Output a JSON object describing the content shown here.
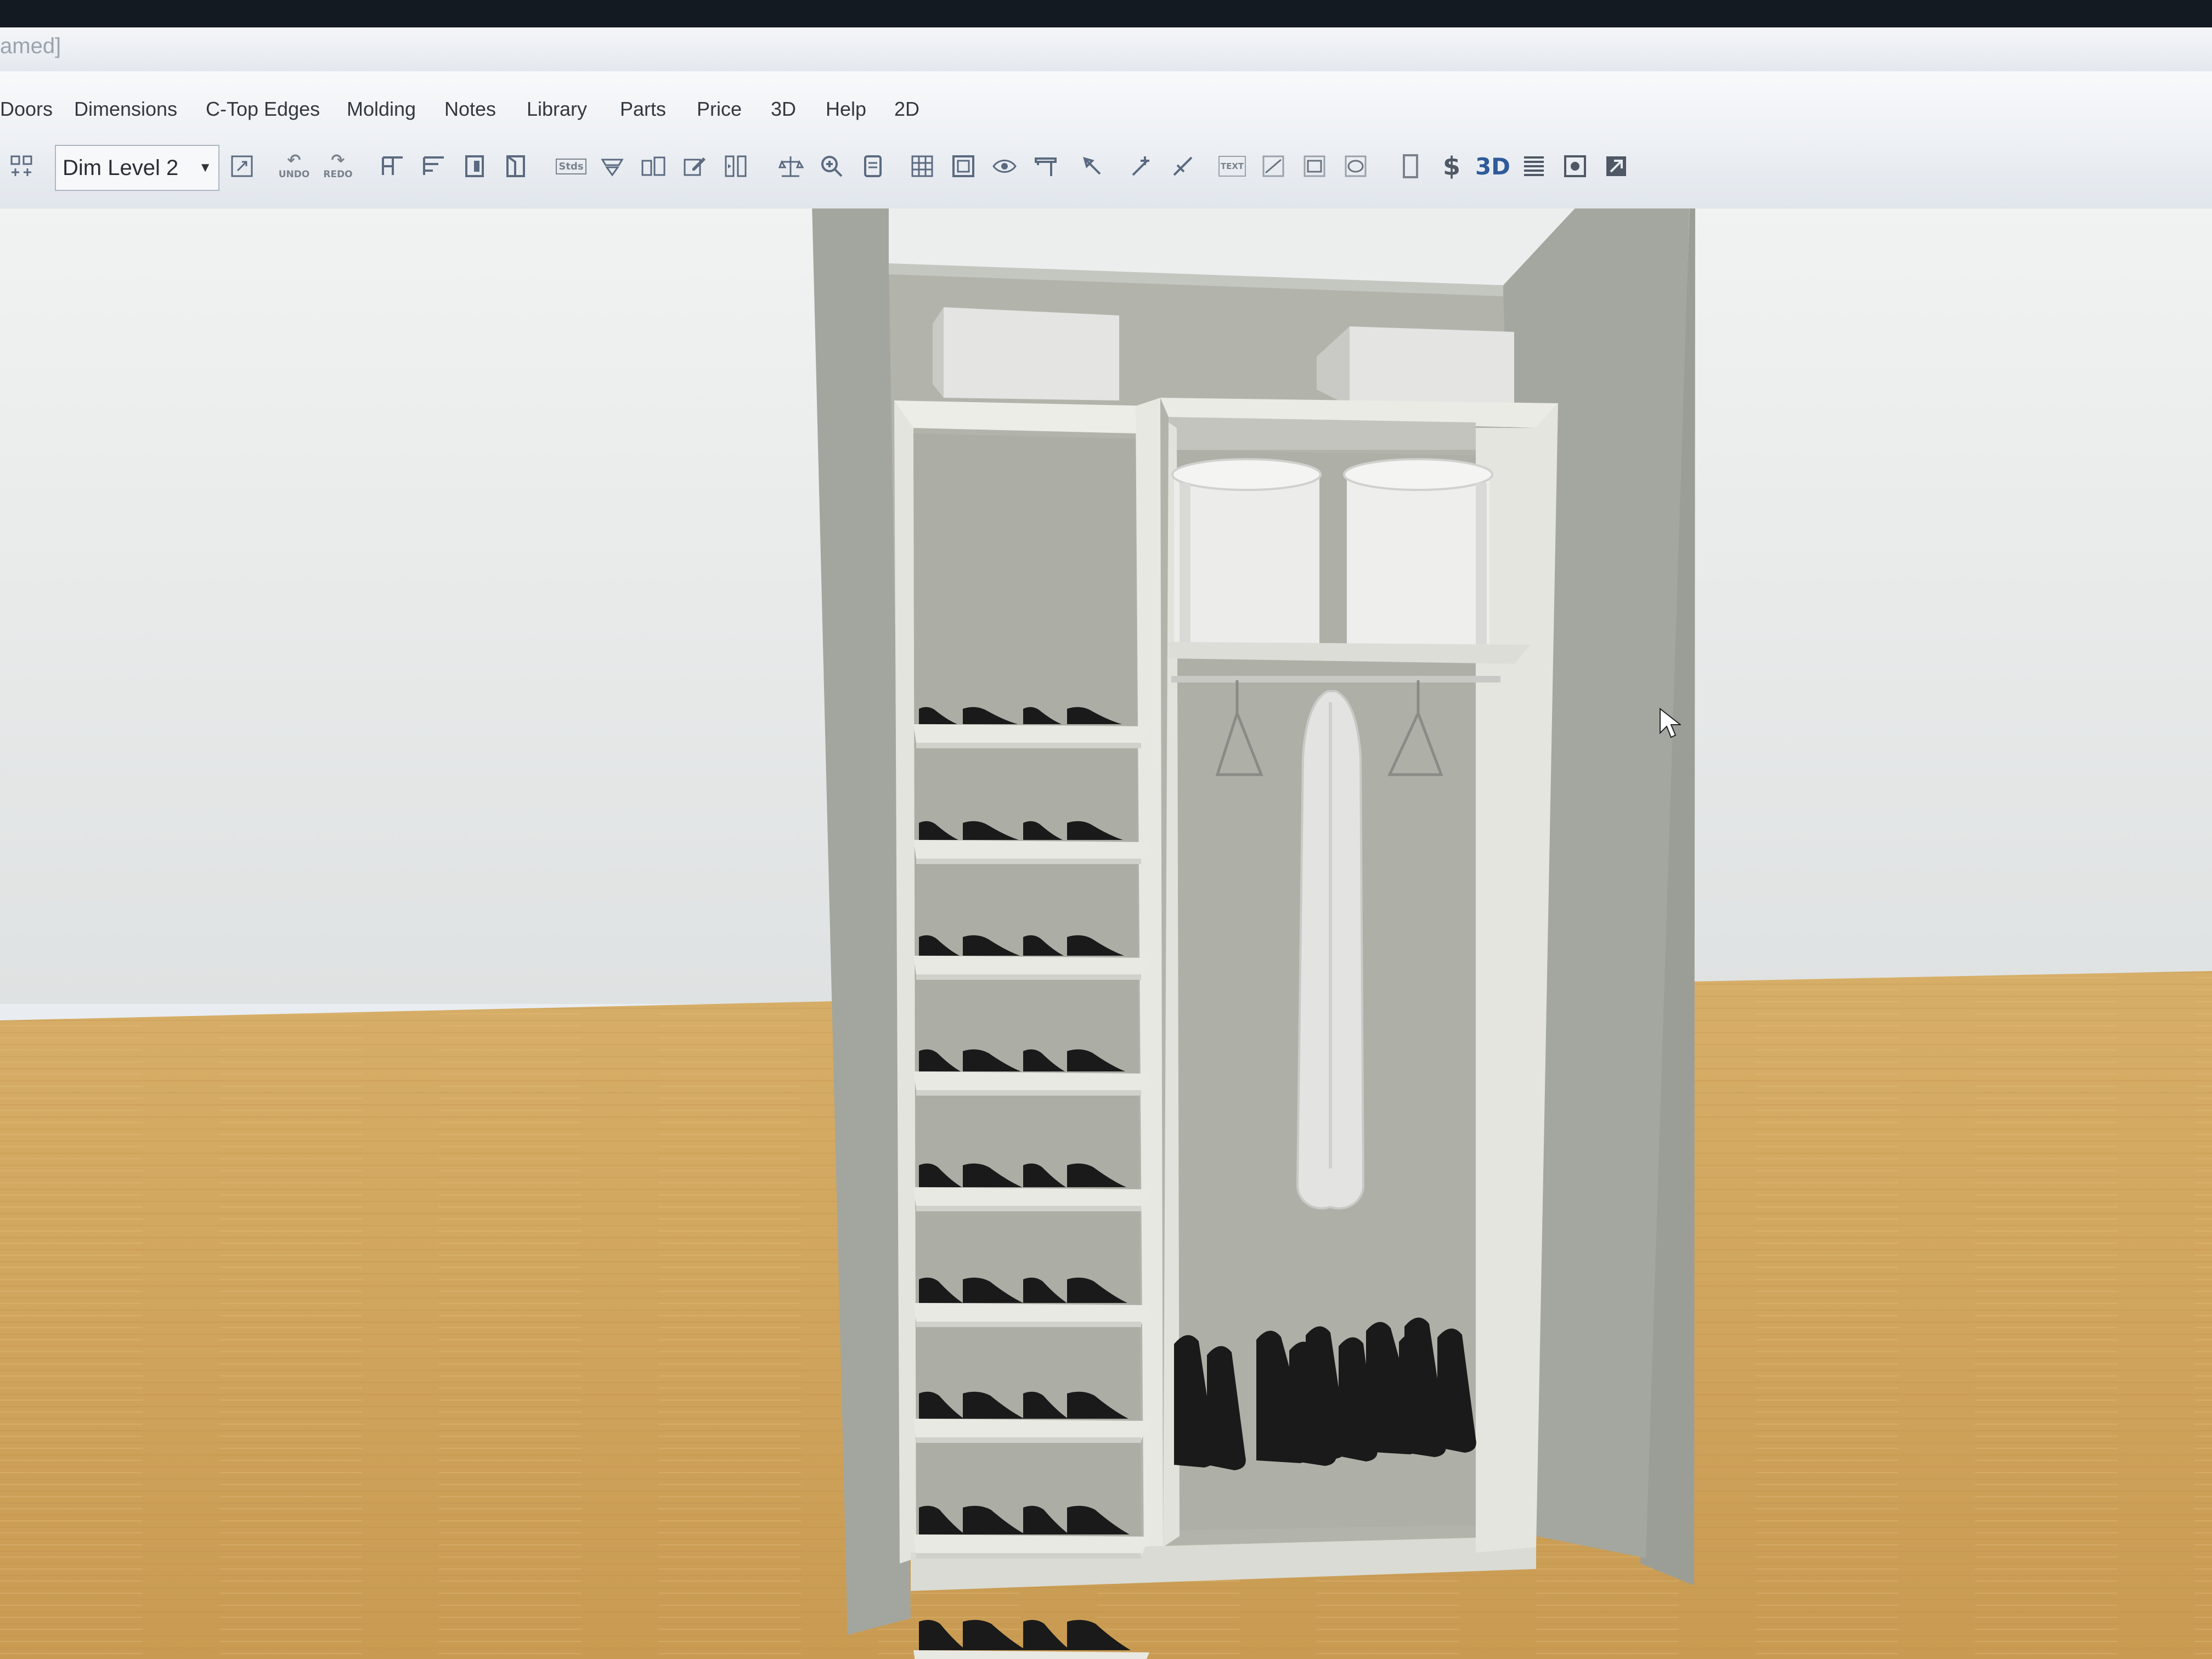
{
  "app": {
    "title_fragment": "amed]"
  },
  "menu": {
    "items": [
      {
        "label": "Doors"
      },
      {
        "label": "Dimensions"
      },
      {
        "label": "C-Top Edges"
      },
      {
        "label": "Molding"
      },
      {
        "label": "Notes"
      },
      {
        "label": "Library"
      },
      {
        "label": "Parts"
      },
      {
        "label": "Price"
      },
      {
        "label": "3D"
      },
      {
        "label": "Help"
      },
      {
        "label": "2D"
      }
    ]
  },
  "toolbar": {
    "dim_level": "Dim Level 2",
    "undo_label": "UNDO",
    "redo_label": "REDO",
    "stds_label": "Stds",
    "text_label": "TEXT",
    "price_symbol": "$",
    "view3d_label": "3D",
    "tools": [
      "grid-add-icon",
      "zoom-extents-icon",
      "undo-icon",
      "redo-icon",
      "wall-cabinet-icon",
      "base-cabinet-icon",
      "tall-cabinet-icon",
      "corner-cabinet-icon",
      "stds-icon",
      "filler-icon",
      "divide-icon",
      "edit-icon",
      "split-icon",
      "measure-icon",
      "zoom-icon",
      "page-icon",
      "grid-icon",
      "frame-icon",
      "eye-icon",
      "shelf-icon",
      "pick-icon",
      "add-point-icon",
      "line-tool-icon",
      "text-icon",
      "line-icon",
      "rectangle-icon",
      "ellipse-icon",
      "door-icon",
      "price-icon",
      "view-3d-icon",
      "list-icon",
      "render-icon",
      "export-icon"
    ]
  },
  "colors": {
    "wall": "#e8eaea",
    "floor": "#d4aa63",
    "closet_side": "#a1a49c",
    "closet_back": "#b0b2aa",
    "shelf": "#e9e9e3",
    "shoe": "#1a1a1a"
  },
  "viewport": {
    "scene": "3d-closet-view",
    "left_section_shoe_shelves": 9,
    "right_section": "hanging-rod-with-shoes-below"
  }
}
